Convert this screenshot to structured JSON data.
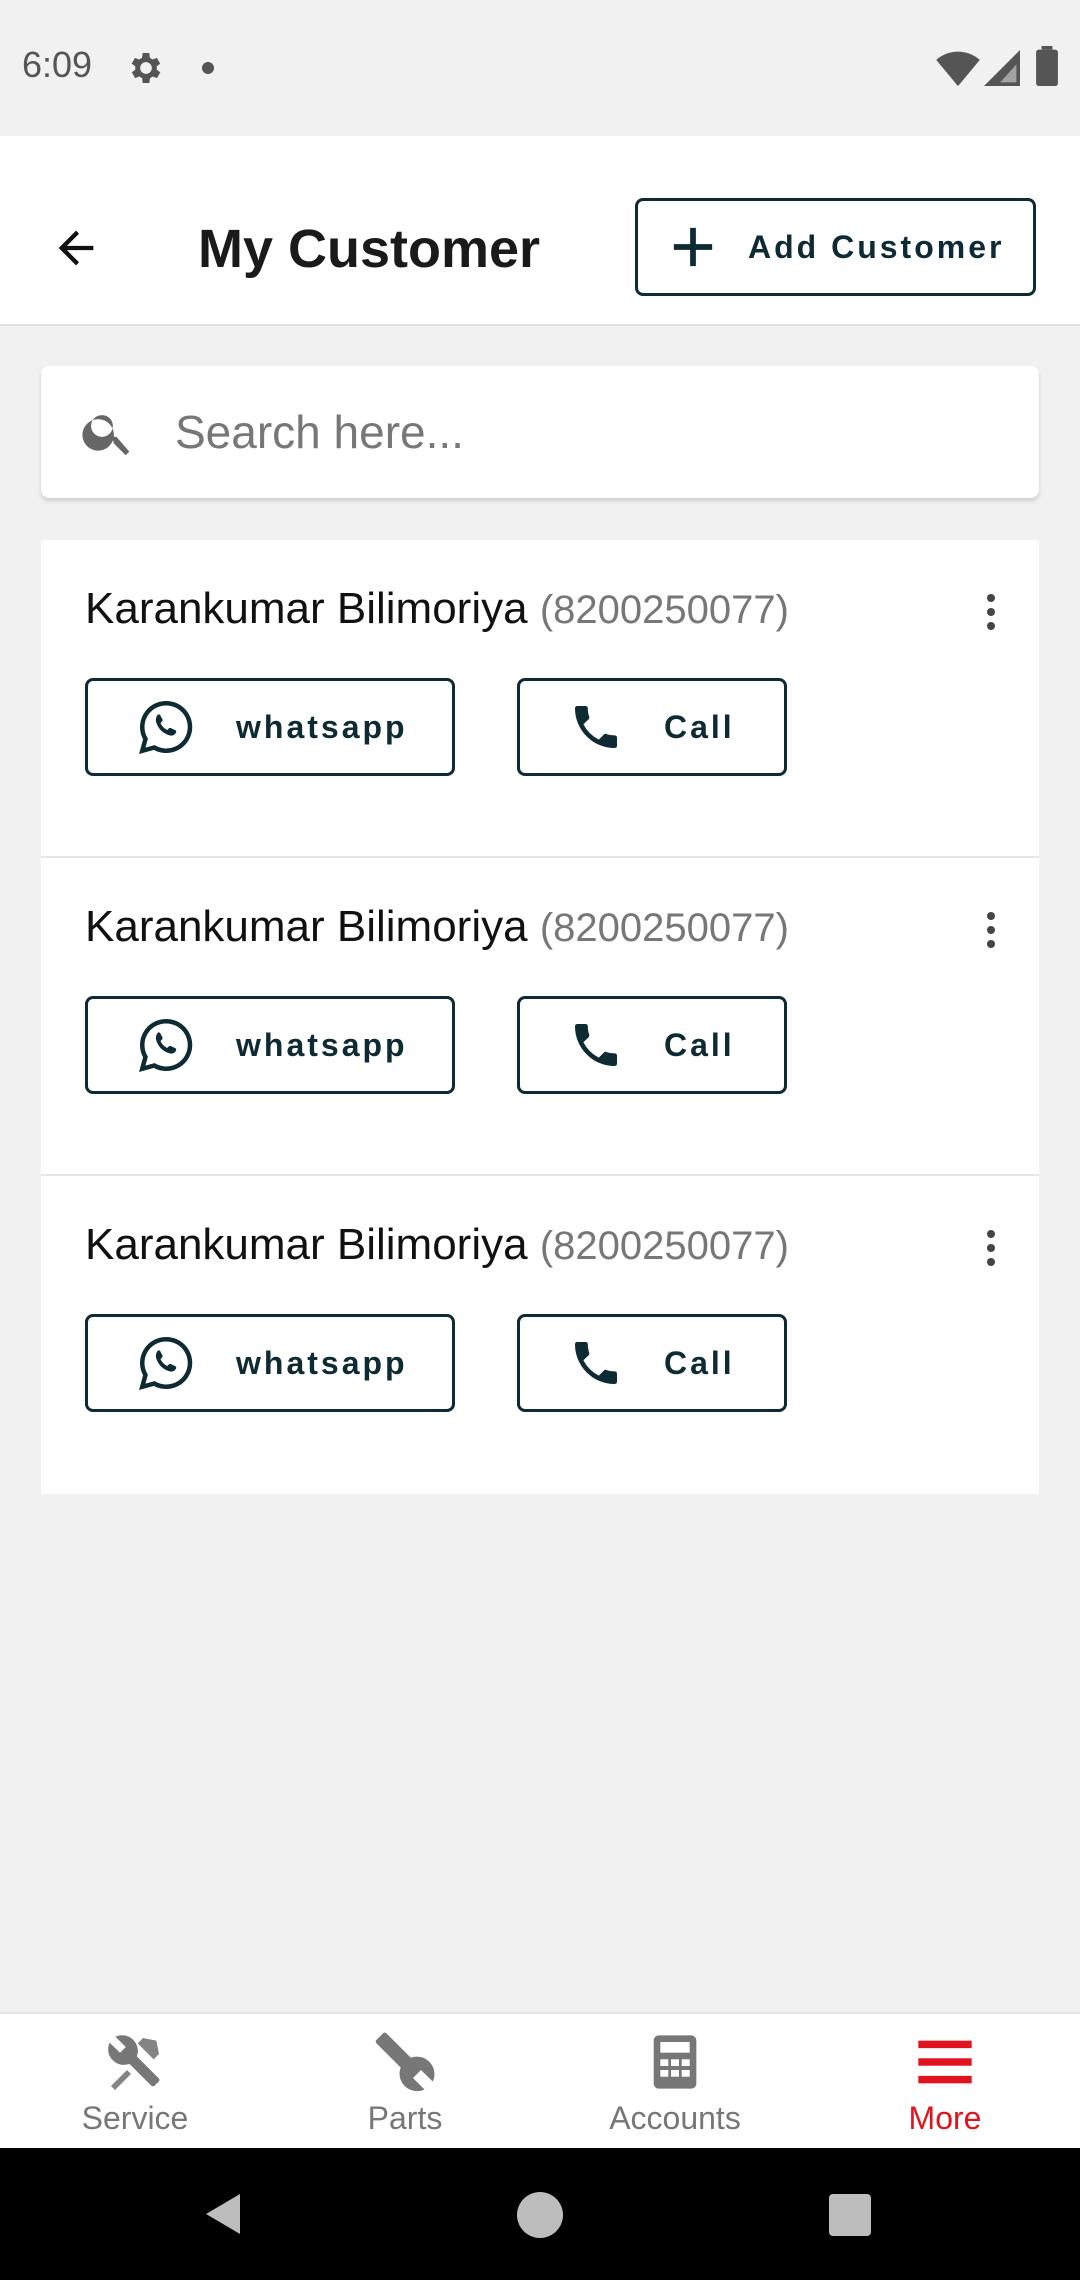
{
  "status_bar": {
    "time": "6:09",
    "icons": [
      "gear-icon",
      "notification-dot",
      "wifi-icon",
      "signal-icon",
      "battery-icon"
    ]
  },
  "header": {
    "back_icon": "arrow-left-icon",
    "title": "My Customer",
    "add_button_label": "Add Customer",
    "add_button_icon": "plus-icon"
  },
  "search": {
    "placeholder": "Search here...",
    "value": "",
    "icon": "search-icon"
  },
  "customers": [
    {
      "name": "Karankumar Bilimoriya",
      "phone": "(8200250077)",
      "whatsapp_label": "whatsapp",
      "call_label": "Call"
    },
    {
      "name": "Karankumar Bilimoriya",
      "phone": "(8200250077)",
      "whatsapp_label": "whatsapp",
      "call_label": "Call"
    },
    {
      "name": "Karankumar Bilimoriya",
      "phone": "(8200250077)",
      "whatsapp_label": "whatsapp",
      "call_label": "Call"
    }
  ],
  "bottom_nav": {
    "items": [
      {
        "label": "Service",
        "icon": "tools-icon",
        "active": false
      },
      {
        "label": "Parts",
        "icon": "wrench-icon",
        "active": false
      },
      {
        "label": "Accounts",
        "icon": "calculator-icon",
        "active": false
      },
      {
        "label": "More",
        "icon": "menu-icon",
        "active": true
      }
    ]
  },
  "colors": {
    "accent": "#e0141e",
    "button_border": "#0e2a32",
    "background": "#f1f1f1",
    "muted_text": "#777777"
  }
}
